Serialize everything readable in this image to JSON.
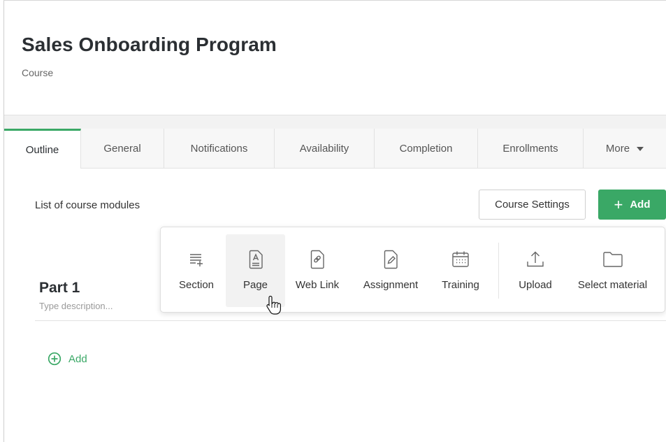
{
  "header": {
    "title": "Sales Onboarding Program",
    "subtitle": "Course"
  },
  "tabs": [
    {
      "label": "Outline",
      "active": true
    },
    {
      "label": "General"
    },
    {
      "label": "Notifications"
    },
    {
      "label": "Availability"
    },
    {
      "label": "Completion"
    },
    {
      "label": "Enrollments"
    },
    {
      "label": "More"
    }
  ],
  "main": {
    "list_title": "List of course modules",
    "course_settings_label": "Course Settings",
    "add_label": "Add"
  },
  "add_menu": {
    "items": [
      {
        "label": "Section",
        "icon": "section-add-icon"
      },
      {
        "label": "Page",
        "icon": "page-icon"
      },
      {
        "label": "Web Link",
        "icon": "web-link-icon"
      },
      {
        "label": "Assignment",
        "icon": "assignment-icon"
      },
      {
        "label": "Training",
        "icon": "calendar-icon"
      },
      {
        "label": "Upload",
        "icon": "upload-icon"
      },
      {
        "label": "Select material",
        "icon": "folder-icon"
      }
    ]
  },
  "part": {
    "title": "Part 1",
    "description_placeholder": "Type description..."
  },
  "inline_add_label": "Add",
  "colors": {
    "accent": "#3aa866",
    "text": "#333333",
    "muted": "#9a9a9a"
  }
}
